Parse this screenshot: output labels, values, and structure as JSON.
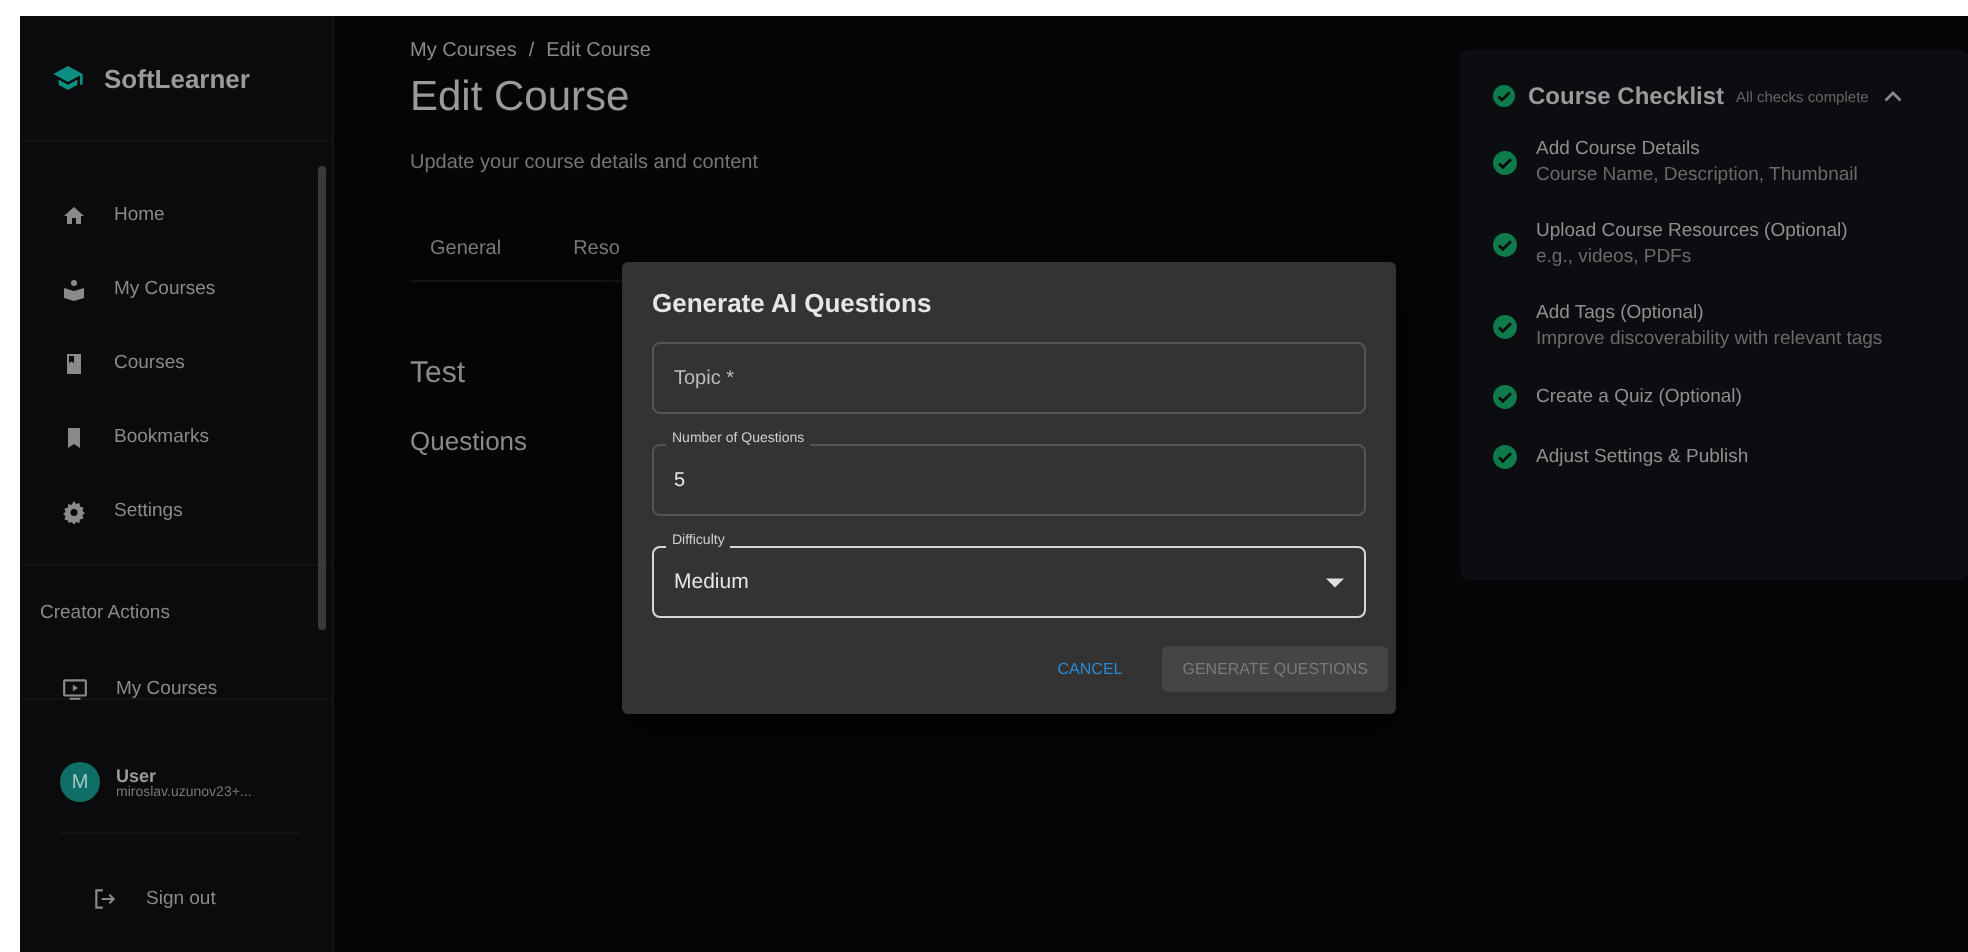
{
  "sidebar": {
    "brand": "SoftLearner",
    "nav_items": [
      {
        "label": "Home"
      },
      {
        "label": "My Courses"
      },
      {
        "label": "Courses"
      },
      {
        "label": "Bookmarks"
      },
      {
        "label": "Settings"
      }
    ],
    "section_title": "Creator Actions",
    "creator_items": [
      {
        "label": "My Courses"
      }
    ],
    "user": {
      "avatar": "M",
      "name": "User",
      "email": "miroslav.uzunov23+..."
    },
    "sign_out": "Sign out"
  },
  "breadcrumb": [
    "My Courses",
    "Edit Course"
  ],
  "breadcrumb_separator": "/",
  "page_title": "Edit Course",
  "page_subtitle": "Update your course details and content",
  "tabs": [
    {
      "label": "General",
      "selected": false
    },
    {
      "label": "Reso",
      "selected": false
    }
  ],
  "quiz_title": "Test",
  "questions_heading": "Questions",
  "checklist": {
    "title": "Course Checklist",
    "status": "All checks complete",
    "expanded": true,
    "items": [
      {
        "title": "Add Course Details",
        "subtitle": "Course Name, Description, Thumbnail",
        "done": true
      },
      {
        "title": "Upload Course Resources (Optional)",
        "subtitle": "e.g., videos, PDFs",
        "done": true
      },
      {
        "title": "Add Tags (Optional)",
        "subtitle": "Improve discoverability with relevant tags",
        "done": true
      },
      {
        "title": "Create a Quiz (Optional)",
        "done": true
      },
      {
        "title": "Adjust Settings & Publish",
        "done": true
      }
    ]
  },
  "dialog": {
    "title": "Generate AI Questions",
    "fields": [
      {
        "kind": "text",
        "placeholder": "Topic *",
        "focused": false
      },
      {
        "kind": "text",
        "label": "Number of Questions",
        "value": "5",
        "focused": false
      },
      {
        "kind": "select",
        "label": "Difficulty",
        "value": "Medium",
        "focused": true
      }
    ],
    "buttons": [
      {
        "label": "CANCEL",
        "kind": "text",
        "disabled": false
      },
      {
        "label": "GENERATE QUESTIONS",
        "kind": "contained",
        "disabled": true
      }
    ]
  }
}
